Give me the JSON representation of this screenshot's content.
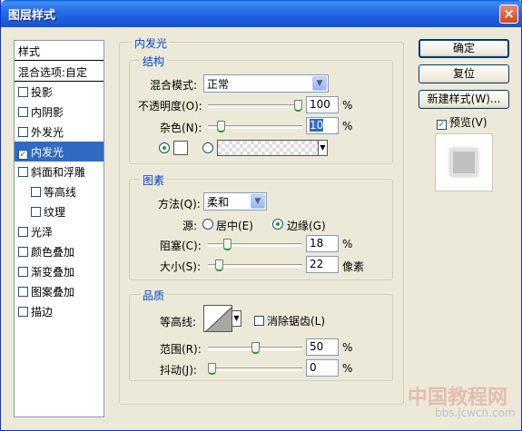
{
  "window": {
    "title": "图层样式",
    "close_label": "×"
  },
  "left_panel": {
    "header": "样式",
    "items": [
      {
        "label": "混合选项:自定",
        "checkbox": false,
        "checked": false,
        "selected": false,
        "indent": false
      },
      {
        "label": "投影",
        "checkbox": true,
        "checked": false,
        "selected": false,
        "indent": false
      },
      {
        "label": "内阴影",
        "checkbox": true,
        "checked": false,
        "selected": false,
        "indent": false
      },
      {
        "label": "外发光",
        "checkbox": true,
        "checked": false,
        "selected": false,
        "indent": false
      },
      {
        "label": "内发光",
        "checkbox": true,
        "checked": true,
        "selected": true,
        "indent": false
      },
      {
        "label": "斜面和浮雕",
        "checkbox": true,
        "checked": false,
        "selected": false,
        "indent": false
      },
      {
        "label": "等高线",
        "checkbox": true,
        "checked": false,
        "selected": false,
        "indent": true
      },
      {
        "label": "纹理",
        "checkbox": true,
        "checked": false,
        "selected": false,
        "indent": true
      },
      {
        "label": "光泽",
        "checkbox": true,
        "checked": false,
        "selected": false,
        "indent": false
      },
      {
        "label": "颜色叠加",
        "checkbox": true,
        "checked": false,
        "selected": false,
        "indent": false
      },
      {
        "label": "渐变叠加",
        "checkbox": true,
        "checked": false,
        "selected": false,
        "indent": false
      },
      {
        "label": "图案叠加",
        "checkbox": true,
        "checked": false,
        "selected": false,
        "indent": false
      },
      {
        "label": "描边",
        "checkbox": true,
        "checked": false,
        "selected": false,
        "indent": false
      }
    ],
    "checkmark": "✓"
  },
  "buttons": {
    "ok": "确定",
    "reset": "复位",
    "new_style": "新建样式(W)...",
    "preview_label": "预览(V)",
    "preview_checked": true
  },
  "inner_glow": {
    "title": "内发光",
    "structure": {
      "title": "结构",
      "blend_mode_label": "混合模式:",
      "blend_mode_value": "正常",
      "opacity_label": "不透明度(O):",
      "opacity_value": "100",
      "opacity_fraction": 1.0,
      "noise_label": "杂色(N):",
      "noise_value": "10",
      "noise_fraction": 0.1,
      "percent": "%"
    },
    "elements": {
      "title": "图素",
      "method_label": "方法(Q):",
      "method_value": "柔和",
      "source_label": "源:",
      "source_center": "居中(E)",
      "source_edge": "边缘(G)",
      "choke_label": "阻塞(C):",
      "choke_value": "18",
      "choke_fraction": 0.18,
      "size_label": "大小(S):",
      "size_value": "22",
      "size_fraction": 0.088,
      "size_unit": "像素",
      "percent": "%"
    },
    "quality": {
      "title": "品质",
      "contour_label": "等高线:",
      "antialias_label": "消除锯齿(L)",
      "range_label": "范围(R):",
      "range_value": "50",
      "range_fraction": 0.5,
      "jitter_label": "抖动(J):",
      "jitter_value": "0",
      "jitter_fraction": 0.0,
      "percent": "%"
    }
  },
  "watermark": {
    "text": "中国教程网",
    "url": "bbs.jcwcn.com"
  },
  "colors": {
    "selection": "#316ac5",
    "legend": "#0046d5",
    "check": "#21a121"
  }
}
